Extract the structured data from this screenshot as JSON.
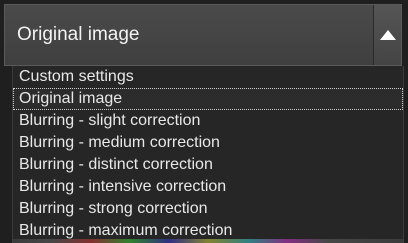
{
  "combo": {
    "selected_value": "Original image",
    "button_icon": "caret-up-icon"
  },
  "dropdown": {
    "items": [
      {
        "label": "Custom settings"
      },
      {
        "label": "Original image",
        "selected": true
      },
      {
        "label": "Blurring - slight correction"
      },
      {
        "label": "Blurring - medium correction"
      },
      {
        "label": "Blurring - distinct correction"
      },
      {
        "label": "Blurring - intensive correction"
      },
      {
        "label": "Blurring - strong correction"
      },
      {
        "label": "Blurring - maximum correction"
      }
    ]
  },
  "colors": {
    "background": "#1f1f1f",
    "combo_bg": "#454545",
    "text": "#f2f2f2",
    "list_bg": "#262626"
  }
}
